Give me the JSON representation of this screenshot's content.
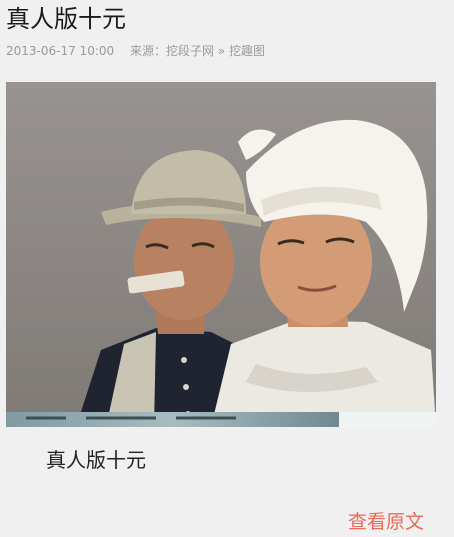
{
  "article": {
    "title": "真人版十元",
    "date": "2013-06-17 10:00",
    "source_label": "来源：",
    "source_name": "挖段子网",
    "separator": "»",
    "category": "挖趣图",
    "image_alt": "two men in photo",
    "caption": "真人版十元",
    "view_original": "查看原文"
  },
  "colors": {
    "background": "#f0f0f0",
    "meta_text": "#9a9a9a",
    "link_accent": "#e86a5a"
  }
}
